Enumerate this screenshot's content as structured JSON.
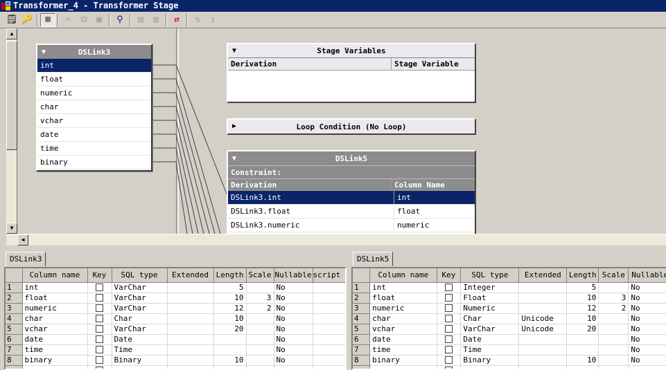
{
  "window": {
    "title": "Transformer_4 - Transformer Stage"
  },
  "toolbar": {
    "buttons": [
      {
        "icon": "properties-icon",
        "glyph": "📋"
      },
      {
        "icon": "key-icon",
        "glyph": "🔑"
      },
      {
        "icon": "column-autoloader-icon",
        "glyph": "⊞"
      },
      {
        "icon": "cut-icon",
        "glyph": "✂"
      },
      {
        "icon": "copy-icon",
        "glyph": "⧉"
      },
      {
        "icon": "paste-icon",
        "glyph": "📋"
      },
      {
        "icon": "find-icon",
        "glyph": "🔍"
      },
      {
        "icon": "load-columns-icon",
        "glyph": "▤"
      },
      {
        "icon": "save-columns-icon",
        "glyph": "▥"
      },
      {
        "icon": "column-mapping-icon",
        "glyph": "⇄"
      },
      {
        "icon": "input-link-order-icon",
        "glyph": "⇅"
      },
      {
        "icon": "output-link-order-icon",
        "glyph": "↕"
      }
    ]
  },
  "input_link": {
    "name": "DSLink3",
    "columns": [
      "int",
      "float",
      "numeric",
      "char",
      "vchar",
      "date",
      "time",
      "binary"
    ],
    "selected_index": 0
  },
  "stage_variables": {
    "title": "Stage Variables",
    "col_derivation": "Derivation",
    "col_variable": "Stage Variable"
  },
  "loop_condition": {
    "title": "Loop Condition (No Loop)"
  },
  "output_link": {
    "name": "DSLink5",
    "constraint_label": "Constraint:",
    "col_derivation": "Derivation",
    "col_name": "Column Name",
    "rows": [
      {
        "derivation": "DSLink3.int",
        "column": "int"
      },
      {
        "derivation": "DSLink3.float",
        "column": "float"
      },
      {
        "derivation": "DSLink3.numeric",
        "column": "numeric"
      }
    ]
  },
  "left_table": {
    "tab": "DSLink3",
    "headers": [
      "Column name",
      "Key",
      "SQL type",
      "Extended",
      "Length",
      "Scale",
      "Nullable",
      "script"
    ],
    "rows": [
      {
        "n": "1",
        "name": "int",
        "sql": "VarChar",
        "ext": "",
        "len": "5",
        "scale": "",
        "null": "No"
      },
      {
        "n": "2",
        "name": "float",
        "sql": "VarChar",
        "ext": "",
        "len": "10",
        "scale": "3",
        "null": "No"
      },
      {
        "n": "3",
        "name": "numeric",
        "sql": "VarChar",
        "ext": "",
        "len": "12",
        "scale": "2",
        "null": "No"
      },
      {
        "n": "4",
        "name": "char",
        "sql": "Char",
        "ext": "",
        "len": "10",
        "scale": "",
        "null": "No"
      },
      {
        "n": "5",
        "name": "vchar",
        "sql": "VarChar",
        "ext": "",
        "len": "20",
        "scale": "",
        "null": "No"
      },
      {
        "n": "6",
        "name": "date",
        "sql": "Date",
        "ext": "",
        "len": "",
        "scale": "",
        "null": "No"
      },
      {
        "n": "7",
        "name": "time",
        "sql": "Time",
        "ext": "",
        "len": "",
        "scale": "",
        "null": "No"
      },
      {
        "n": "8",
        "name": "binary",
        "sql": "Binary",
        "ext": "",
        "len": "10",
        "scale": "",
        "null": "No"
      }
    ]
  },
  "right_table": {
    "tab": "DSLink5",
    "headers": [
      "Column name",
      "Key",
      "SQL type",
      "Extended",
      "Length",
      "Scale",
      "Nullable"
    ],
    "rows": [
      {
        "n": "1",
        "name": "int",
        "sql": "Integer",
        "ext": "",
        "len": "5",
        "scale": "",
        "null": "No"
      },
      {
        "n": "2",
        "name": "float",
        "sql": "Float",
        "ext": "",
        "len": "10",
        "scale": "3",
        "null": "No"
      },
      {
        "n": "3",
        "name": "numeric",
        "sql": "Numeric",
        "ext": "",
        "len": "12",
        "scale": "2",
        "null": "No"
      },
      {
        "n": "4",
        "name": "char",
        "sql": "Char",
        "ext": "Unicode",
        "len": "10",
        "scale": "",
        "null": "No"
      },
      {
        "n": "5",
        "name": "vchar",
        "sql": "VarChar",
        "ext": "Unicode",
        "len": "20",
        "scale": "",
        "null": "No"
      },
      {
        "n": "6",
        "name": "date",
        "sql": "Date",
        "ext": "",
        "len": "",
        "scale": "",
        "null": "No"
      },
      {
        "n": "7",
        "name": "time",
        "sql": "Time",
        "ext": "",
        "len": "",
        "scale": "",
        "null": "No"
      },
      {
        "n": "8",
        "name": "binary",
        "sql": "Binary",
        "ext": "",
        "len": "10",
        "scale": "",
        "null": "No"
      }
    ]
  }
}
